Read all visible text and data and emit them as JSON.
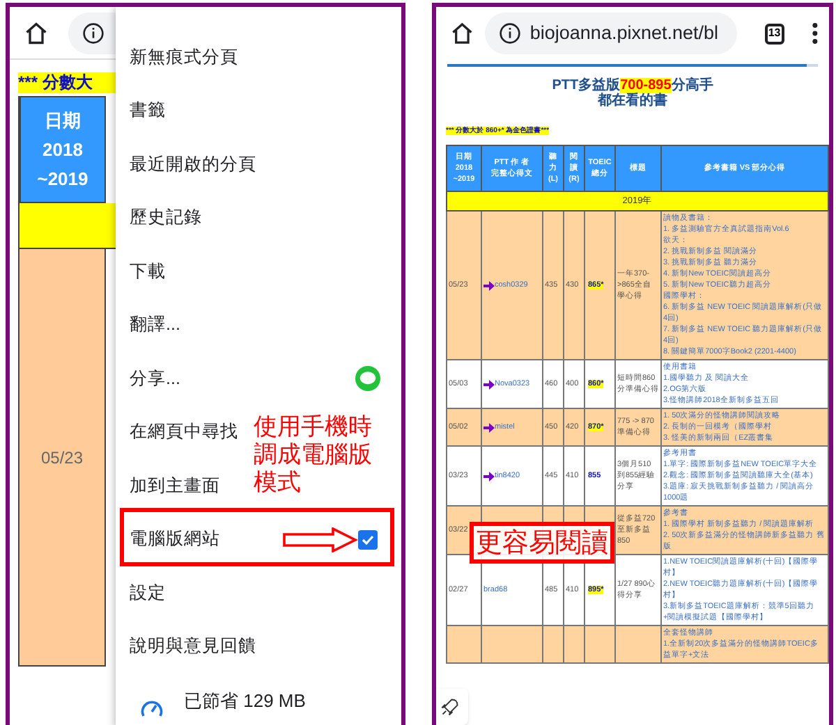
{
  "left_screen": {
    "page": {
      "banner": "*** 分數大",
      "header_cell": [
        "日期",
        "2018",
        "~2019"
      ],
      "row_date": "05/23"
    },
    "menu": {
      "items": [
        {
          "label": "新無痕式分頁",
          "kind": "plain"
        },
        {
          "label": "書籤",
          "kind": "plain"
        },
        {
          "label": "最近開啟的分頁",
          "kind": "plain"
        },
        {
          "label": "歷史記錄",
          "kind": "plain"
        },
        {
          "label": "下載",
          "kind": "plain"
        },
        {
          "label": "翻譯...",
          "kind": "plain"
        },
        {
          "label": "分享...",
          "kind": "share"
        },
        {
          "label": "在網頁中尋找",
          "kind": "plain"
        },
        {
          "label": "加到主畫面",
          "kind": "plain"
        },
        {
          "label": "電腦版網站",
          "kind": "checkbox",
          "checked": true
        },
        {
          "label": "設定",
          "kind": "plain"
        },
        {
          "label": "說明與意見回饋",
          "kind": "plain"
        },
        {
          "label": "已節省 129 MB",
          "kind": "savings"
        }
      ]
    },
    "annotation": {
      "lines": [
        "使用手機時",
        "調成電腦版",
        "模式"
      ]
    }
  },
  "right_screen": {
    "toolbar": {
      "url": "biojoanna.pixnet.net/bl",
      "tab_count": "13",
      "progress": {
        "level": 0.97
      }
    },
    "title": [
      {
        "text": "PTT多益版",
        "emphasis": false
      },
      {
        "text": "700-895",
        "emphasis": true
      },
      {
        "text": "分高手",
        "emphasis": false
      }
    ],
    "subtitle": "都在看的書",
    "note": "*** 分數大於 860+* 為金色證書***",
    "columns": [
      [
        "日期",
        "2018",
        "~2019"
      ],
      [
        "PTT 作 者",
        "完整心得文"
      ],
      [
        "聽",
        "力",
        "(L)"
      ],
      [
        "閱",
        "讀",
        "(R)"
      ],
      [
        "TOEIC",
        "總分"
      ],
      [
        "標題"
      ],
      [
        "參考書籍 VS 部分心得"
      ]
    ],
    "year": "2019年",
    "rows": [
      {
        "highlighted": true,
        "date": "05/23",
        "author": "cosh0329",
        "arrow": true,
        "listening": "435",
        "reading": "430",
        "total": "865*",
        "gold": true,
        "title": "一年370->865全自學心得",
        "refs": [
          "讀物及書籍：",
          "1. 多益測驗官方全真試題指南Vol.6",
          "欲天：",
          "2. 挑戰新制多益 閱讀滿分",
          "3. 挑戰新制多益 聽力滿分",
          "4. 新制New TOEIC閱讀超高分",
          "5. 新制New TOEIC聽力超高分",
          "國際學村：",
          "6. 新制多益 NEW TOEIC 閱讀題庫解析(只做4回)",
          "7. 新制多益 NEW TOEIC 聽力題庫解析(只做4回)",
          "8. 關鍵簡單7000字Book2 (2201-4400)"
        ]
      },
      {
        "highlighted": false,
        "date": "05/03",
        "author": "Nova0323",
        "arrow": true,
        "listening": "460",
        "reading": "400",
        "total": "860*",
        "gold": true,
        "title": "短時間860分準備心得",
        "refs": [
          "使用書籍",
          "1.國學聽力 及 閱讀大全",
          "2.OG第六版",
          "3.怪物講師2018全新制多益五回"
        ]
      },
      {
        "highlighted": true,
        "date": "05/02",
        "author": "mistel",
        "arrow": true,
        "listening": "450",
        "reading": "420",
        "total": "870*",
        "gold": true,
        "title": "775 -> 870 準備心得",
        "refs": [
          "1. 50次滿分的怪物講師閱讀攻略",
          "2. 長制的一回模考（國際學村",
          "3. 怪美的新制兩回（EZ叢書集"
        ]
      },
      {
        "highlighted": false,
        "date": "03/23",
        "author": "tin8420",
        "arrow": true,
        "listening": "445",
        "reading": "410",
        "total": "855",
        "gold": false,
        "title": "3個月510到855經驗分享",
        "refs": [
          "參考用書",
          "1.單字: 國際新制多益NEW TOEIC單字大全",
          "2.觀念: 國際新制多益閱讀聽庫大全(基本)",
          "3.題庫: 寂天挑戰新制多益聽力 / 閱讀高分1000題"
        ]
      },
      {
        "highlighted": true,
        "date": "03/22",
        "title": "從多益720至新多益850",
        "refs": [
          "參考書",
          "1. 國際學村 新制多益聽力 / 閱讀題庫解析",
          "2. 50次新多益滿分的怪物講師新多益聽力 舊版"
        ]
      },
      {
        "highlighted": false,
        "date": "02/27",
        "author": "brad68",
        "arrow": false,
        "listening": "485",
        "reading": "410",
        "total": "895*",
        "gold": true,
        "title": "1/27 890心得分享",
        "refs": [
          "1.NEW TOEIC閱讀題庫解析(十回)【國際學村】",
          "2.NEW TOEIC聽力題庫解析(十回)【國際學村】",
          "3.新制多益TOEIC題庫解析：競準5回聽力+閱讀模擬試題【國際學村】"
        ]
      },
      {
        "highlighted": true,
        "refs": [
          "全套怪物講師",
          "1.全新制20次多益滿分的怪物講師TOEIC多益單字+文法"
        ]
      }
    ],
    "annotation": "更容易閱讀"
  }
}
